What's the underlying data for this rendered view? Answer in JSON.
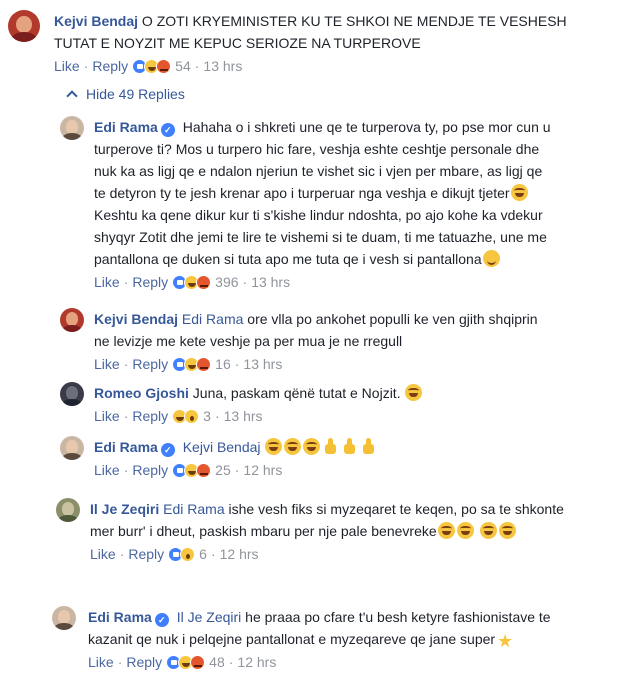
{
  "top_comment": {
    "author": "Kejvi Bendaj",
    "text": "O ZOTI KRYEMINISTER KU TE SHKOI NE MENDJE TE VESHESH TUTAT E NOYZIT ME KEPUC SERIOZE NA TURPEROVE",
    "like": "Like",
    "reply": "Reply",
    "reactions": [
      "like-icon",
      "haha-icon",
      "angry-icon"
    ],
    "count": "54",
    "time": "13 hrs"
  },
  "hide_replies_label": "Hide 49 Replies",
  "replies": [
    {
      "author": "Edi Rama",
      "text": "Hahaha o i shkreti une qe te turperova ty, po pse mor cun u turperove ti? Mos u turpero hic fare, veshja eshte ceshtje personale dhe nuk ka as ligj qe e ndalon njeriun te vishet sic i vjen per mbare, as ligj qe te detyron ty te jesh krenar apo i turperuar nga veshja e dikujt tjeter",
      "text2": " Keshtu ka qene dikur kur ti s'kishe lindur ndoshta, po ajo kohe ka vdekur shyqyr Zotit dhe jemi te lire te vishemi si te duam, ti me tatuazhe, une me pantallona qe duken si tuta apo me tuta qe i vesh si pantallona",
      "like": "Like",
      "reply": "Reply",
      "reactions": [
        "like-icon",
        "haha-icon",
        "angry-icon"
      ],
      "count": "396",
      "time": "13 hrs"
    },
    {
      "author": "Kejvi Bendaj",
      "mention": "Edi Rama",
      "text": " ore vlla po ankohet populli ke ven gjith shqiprin ne levizje me kete veshje pa per mua je ne rregull",
      "like": "Like",
      "reply": "Reply",
      "reactions": [
        "like-icon",
        "haha-icon",
        "angry-icon"
      ],
      "count": "16",
      "time": "13 hrs"
    },
    {
      "author": "Romeo Gjoshi",
      "text": " Juna, paskam qënë tutat e Nojzit.",
      "like": "Like",
      "reply": "Reply",
      "reactions": [
        "haha-icon",
        "wow-icon"
      ],
      "count": "3",
      "time": "13 hrs"
    },
    {
      "author": "Edi Rama",
      "mention": "Kejvi Bendaj",
      "like": "Like",
      "reply": "Reply",
      "reactions": [
        "like-icon",
        "haha-icon",
        "angry-icon"
      ],
      "count": "25",
      "time": "12 hrs"
    },
    {
      "author": "Il Je Zeqiri",
      "mention": "Edi Rama",
      "text": " ishe vesh fiks si myzeqaret te keqen, po sa te shkonte mer burr' i dheut, paskish mbaru per nje pale benevreke",
      "like": "Like",
      "reply": "Reply",
      "reactions": [
        "like-icon",
        "wow-icon"
      ],
      "count": "6",
      "time": "12 hrs"
    },
    {
      "author": "Edi Rama",
      "mention": "Il Je Zeqiri",
      "text": " he praaa po cfare t'u besh ketyre fashionistave te kazanit qe nuk i pelqejne pantallonat e myzeqareve qe jane super",
      "like": "Like",
      "reply": "Reply",
      "reactions": [
        "like-icon",
        "haha-icon",
        "angry-icon"
      ],
      "count": "48",
      "time": "12 hrs"
    }
  ]
}
